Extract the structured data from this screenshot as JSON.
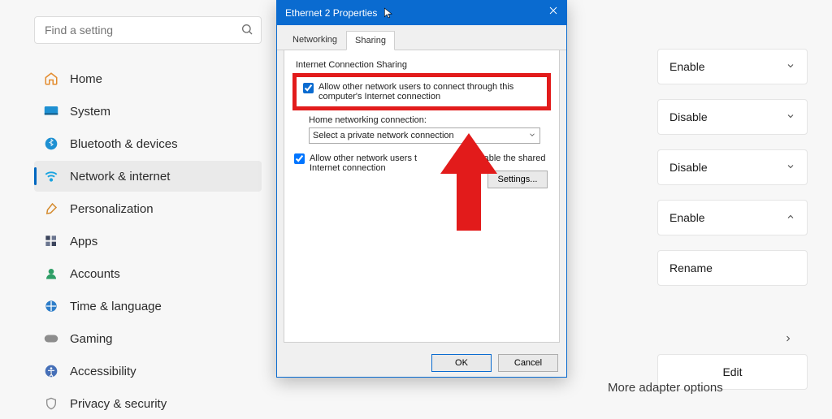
{
  "search": {
    "placeholder": "Find a setting"
  },
  "sidebar": {
    "items": [
      {
        "label": "Home"
      },
      {
        "label": "System"
      },
      {
        "label": "Bluetooth & devices"
      },
      {
        "label": "Network & internet"
      },
      {
        "label": "Personalization"
      },
      {
        "label": "Apps"
      },
      {
        "label": "Accounts"
      },
      {
        "label": "Time & language"
      },
      {
        "label": "Gaming"
      },
      {
        "label": "Accessibility"
      },
      {
        "label": "Privacy & security"
      }
    ]
  },
  "right": {
    "cards": [
      {
        "label": "Enable",
        "chev": "down"
      },
      {
        "label": "Disable",
        "chev": "down"
      },
      {
        "label": "Disable",
        "chev": "down"
      },
      {
        "label": "Enable",
        "chev": "up"
      },
      {
        "label": "Rename",
        "chev": "none"
      }
    ],
    "edit": "Edit",
    "adapter": "More adapter options"
  },
  "dialog": {
    "title": "Ethernet 2 Properties",
    "tabs": {
      "networking": "Networking",
      "sharing": "Sharing"
    },
    "group": "Internet Connection Sharing",
    "chk1": "Allow other network users to connect through this computer's Internet connection",
    "home_label": "Home networking connection:",
    "dropdown": "Select a private network connection",
    "chk2_a": "Allow other network users t",
    "chk2_b": "isable the shared Internet connection",
    "settings_btn": "Settings...",
    "ok": "OK",
    "cancel": "Cancel"
  }
}
